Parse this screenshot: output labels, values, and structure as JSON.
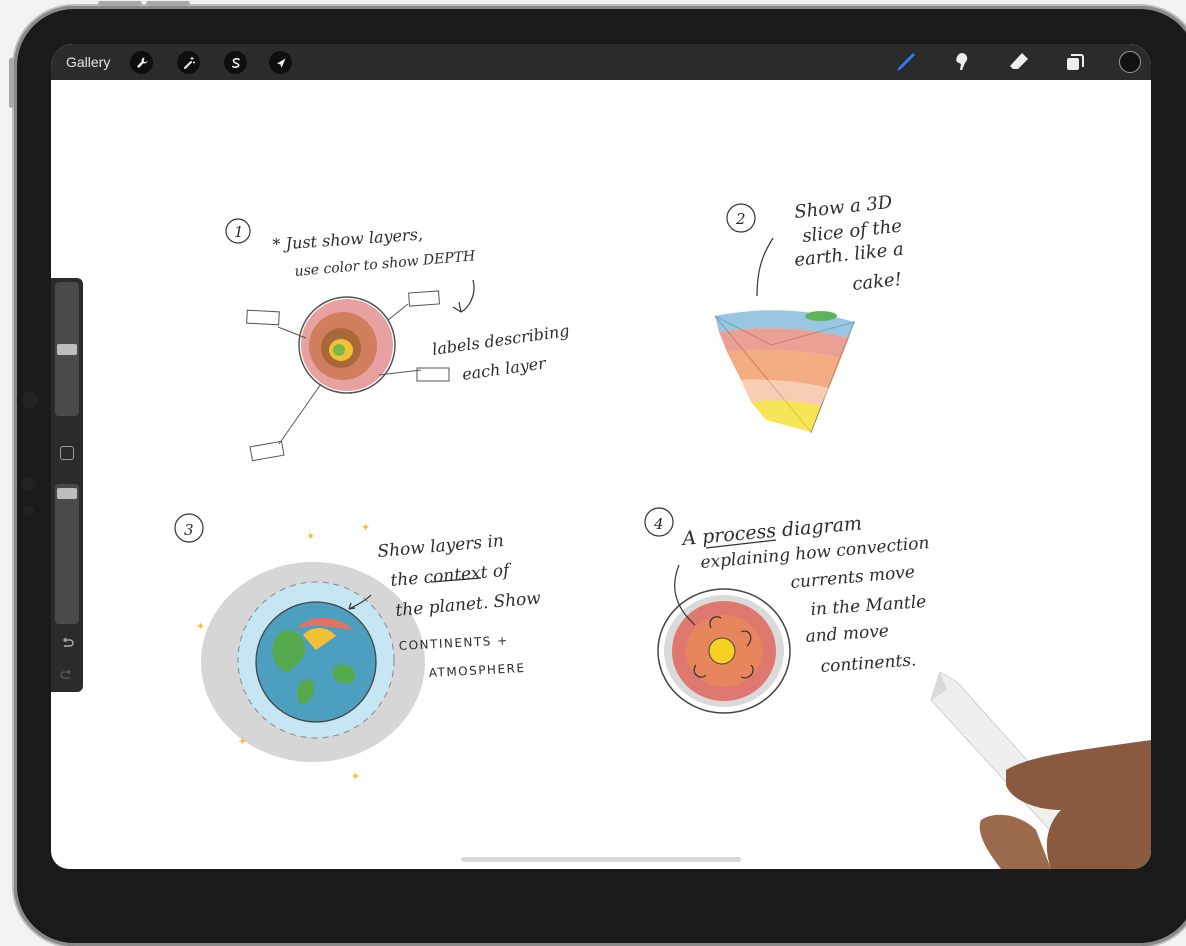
{
  "toolbar": {
    "gallery_label": "Gallery",
    "left_tools": [
      {
        "icon": "wrench-icon",
        "name": "actions"
      },
      {
        "icon": "magic-wand-icon",
        "name": "adjustments"
      },
      {
        "icon": "selection-s-icon",
        "name": "selection"
      },
      {
        "icon": "arrow-cursor-icon",
        "name": "transform"
      }
    ],
    "right_tools": [
      {
        "icon": "brush-icon",
        "name": "paint",
        "active": true
      },
      {
        "icon": "smudge-icon",
        "name": "smudge"
      },
      {
        "icon": "eraser-icon",
        "name": "erase"
      },
      {
        "icon": "layers-icon",
        "name": "layers"
      }
    ],
    "active_color": "#2f7cf6",
    "current_color": "#111111"
  },
  "sidebar": {
    "brush_size_level": 0.47,
    "opacity_level": 0.03,
    "undo_icon": "undo-icon",
    "redo_icon": "redo-icon"
  },
  "sketch": {
    "idea1": {
      "number": "1",
      "note_line1": "* Just show layers,",
      "note_line2": "use color to show DEPTH",
      "labels_line1": "labels describing",
      "labels_line2": "each layer"
    },
    "idea2": {
      "number": "2",
      "line1": "Show a 3D",
      "line2": "slice of the",
      "line3": "earth. like a",
      "line4": "cake!"
    },
    "idea3": {
      "number": "3",
      "line1": "Show layers in",
      "line2": "the context of",
      "line3": "the planet. Show",
      "caps1": "CONTINENTS +",
      "caps2": "ATMOSPHERE"
    },
    "idea4": {
      "number": "4",
      "line1": "A process diagram",
      "line2": "explaining how convection",
      "line3": "currents move",
      "line4": "in the Mantle",
      "line5": "and move",
      "line6": "continents."
    }
  }
}
